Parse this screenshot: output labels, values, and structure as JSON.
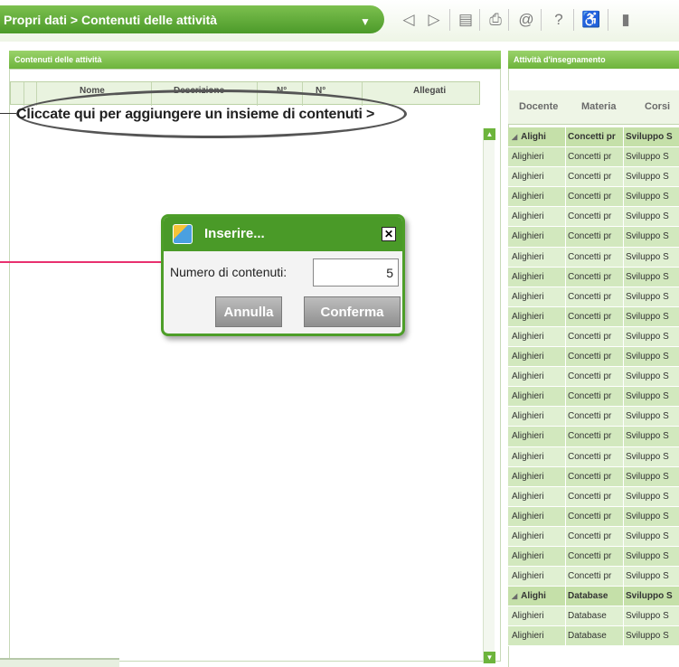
{
  "header": {
    "breadcrumb": "Propri dati > Contenuti delle attività",
    "toolbar_icons": [
      "back-icon",
      "forward-icon",
      "document-icon",
      "print-icon",
      "email-icon",
      "help-icon",
      "accessibility-icon",
      "more-icon"
    ]
  },
  "left_panel": {
    "title": "Contenuti delle attività",
    "columns": [
      "Nome",
      "Descrizione",
      "N°",
      "N°",
      "Allegati"
    ],
    "add_row_text": "Cliccate qui per aggiungere un insieme di contenuti >"
  },
  "dialog": {
    "title": "Inserire...",
    "field_label": "Numero di contenuti:",
    "field_value": "5",
    "cancel_label": "Annulla",
    "confirm_label": "Conferma"
  },
  "right_panel": {
    "title": "Attività d'insegnamento",
    "columns": [
      "Docente",
      "Materia",
      "Corsi"
    ],
    "rows": [
      {
        "group": true,
        "docente": "Alighi",
        "materia": "Concetti pr",
        "corsi": "Sviluppo S"
      },
      {
        "docente": "Alighieri",
        "materia": "Concetti pr",
        "corsi": "Sviluppo S"
      },
      {
        "docente": "Alighieri",
        "materia": "Concetti pr",
        "corsi": "Sviluppo S"
      },
      {
        "docente": "Alighieri",
        "materia": "Concetti pr",
        "corsi": "Sviluppo S"
      },
      {
        "docente": "Alighieri",
        "materia": "Concetti pr",
        "corsi": "Sviluppo S"
      },
      {
        "docente": "Alighieri",
        "materia": "Concetti pr",
        "corsi": "Sviluppo S"
      },
      {
        "docente": "Alighieri",
        "materia": "Concetti pr",
        "corsi": "Sviluppo S"
      },
      {
        "docente": "Alighieri",
        "materia": "Concetti pr",
        "corsi": "Sviluppo S"
      },
      {
        "docente": "Alighieri",
        "materia": "Concetti pr",
        "corsi": "Sviluppo S"
      },
      {
        "docente": "Alighieri",
        "materia": "Concetti pr",
        "corsi": "Sviluppo S"
      },
      {
        "docente": "Alighieri",
        "materia": "Concetti pr",
        "corsi": "Sviluppo S"
      },
      {
        "docente": "Alighieri",
        "materia": "Concetti pr",
        "corsi": "Sviluppo S"
      },
      {
        "docente": "Alighieri",
        "materia": "Concetti pr",
        "corsi": "Sviluppo S"
      },
      {
        "docente": "Alighieri",
        "materia": "Concetti pr",
        "corsi": "Sviluppo S"
      },
      {
        "docente": "Alighieri",
        "materia": "Concetti pr",
        "corsi": "Sviluppo S"
      },
      {
        "docente": "Alighieri",
        "materia": "Concetti pr",
        "corsi": "Sviluppo S"
      },
      {
        "docente": "Alighieri",
        "materia": "Concetti pr",
        "corsi": "Sviluppo S"
      },
      {
        "docente": "Alighieri",
        "materia": "Concetti pr",
        "corsi": "Sviluppo S"
      },
      {
        "docente": "Alighieri",
        "materia": "Concetti pr",
        "corsi": "Sviluppo S"
      },
      {
        "docente": "Alighieri",
        "materia": "Concetti pr",
        "corsi": "Sviluppo S"
      },
      {
        "docente": "Alighieri",
        "materia": "Concetti pr",
        "corsi": "Sviluppo S"
      },
      {
        "docente": "Alighieri",
        "materia": "Concetti pr",
        "corsi": "Sviluppo S"
      },
      {
        "docente": "Alighieri",
        "materia": "Concetti pr",
        "corsi": "Sviluppo S"
      },
      {
        "group": true,
        "docente": "Alighi",
        "materia": "Database",
        "corsi": "Sviluppo S"
      },
      {
        "docente": "Alighieri",
        "materia": "Database",
        "corsi": "Sviluppo S"
      },
      {
        "docente": "Alighieri",
        "materia": "Database",
        "corsi": "Sviluppo S"
      }
    ]
  },
  "colors": {
    "accent_green": "#4a9a28",
    "highlight_arrow": "#e8306f"
  }
}
